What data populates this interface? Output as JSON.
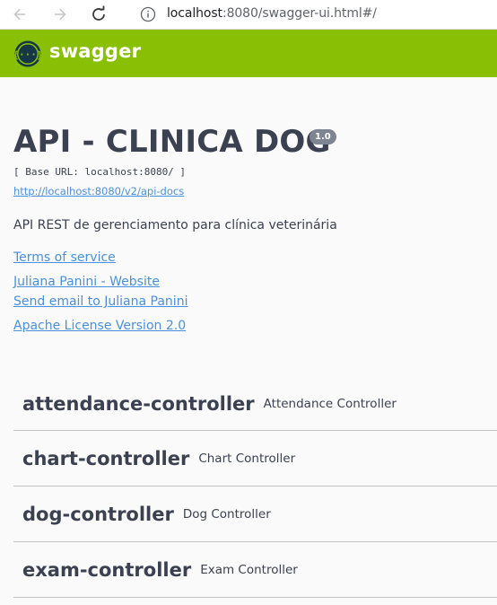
{
  "browser": {
    "url_host": "localhost",
    "url_rest": ":8080/swagger-ui.html#/"
  },
  "header": {
    "logo_text": "swagger",
    "color": "#89bf04"
  },
  "info": {
    "title": "API - CLINICA DOG",
    "version": "1.0",
    "base_url": "[ Base URL: localhost:8080/ ]",
    "docs_url": "http://localhost:8080/v2/api-docs",
    "description": "API REST de gerenciamento para clínica veterinária",
    "links": {
      "terms": "Terms of service",
      "website": "Juliana Panini - Website",
      "email": "Send email to Juliana Panini",
      "license": "Apache License Version 2.0"
    }
  },
  "controllers": [
    {
      "name": "attendance-controller",
      "description": "Attendance Controller"
    },
    {
      "name": "chart-controller",
      "description": "Chart Controller"
    },
    {
      "name": "dog-controller",
      "description": "Dog Controller"
    },
    {
      "name": "exam-controller",
      "description": "Exam Controller"
    }
  ]
}
